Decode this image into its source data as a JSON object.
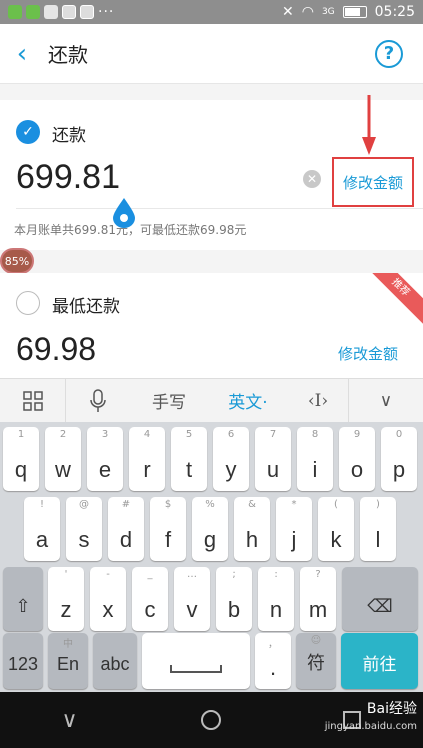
{
  "status_bar": {
    "network": "3G",
    "time": "05:25",
    "dots": "···"
  },
  "header": {
    "title": "还款",
    "back_icon": "‹",
    "help_icon": "?"
  },
  "repay_full": {
    "label": "还款",
    "amount": "699.81",
    "edit_label": "修改金额",
    "summary": "本月账单共699.81元，可最低还款69.98元"
  },
  "progress_badge": "85%",
  "repay_min": {
    "label": "最低还款",
    "amount": "69.98",
    "edit_label": "修改金额",
    "ribbon": "推荐"
  },
  "keyboard_toolbar": {
    "grid_icon": "grid-icon",
    "mic_icon": "mic-icon",
    "handwrite": "手写",
    "english": "英文·",
    "cursor": "‹I›",
    "collapse": "∨"
  },
  "keyboard": {
    "row1": [
      {
        "main": "q",
        "sub": "1"
      },
      {
        "main": "w",
        "sub": "2"
      },
      {
        "main": "e",
        "sub": "3"
      },
      {
        "main": "r",
        "sub": "4"
      },
      {
        "main": "t",
        "sub": "5"
      },
      {
        "main": "y",
        "sub": "6"
      },
      {
        "main": "u",
        "sub": "7"
      },
      {
        "main": "i",
        "sub": "8"
      },
      {
        "main": "o",
        "sub": "9"
      },
      {
        "main": "p",
        "sub": "0"
      }
    ],
    "row2": [
      {
        "main": "a",
        "sub": "!"
      },
      {
        "main": "s",
        "sub": "@"
      },
      {
        "main": "d",
        "sub": "#"
      },
      {
        "main": "f",
        "sub": "$"
      },
      {
        "main": "g",
        "sub": "%"
      },
      {
        "main": "h",
        "sub": "&"
      },
      {
        "main": "j",
        "sub": "*"
      },
      {
        "main": "k",
        "sub": "("
      },
      {
        "main": "l",
        "sub": ")"
      }
    ],
    "row3": [
      {
        "main": "z",
        "sub": "'"
      },
      {
        "main": "x",
        "sub": "-"
      },
      {
        "main": "c",
        "sub": "_"
      },
      {
        "main": "v",
        "sub": "…"
      },
      {
        "main": "b",
        "sub": ";"
      },
      {
        "main": "n",
        "sub": ":"
      },
      {
        "main": "m",
        "sub": "?"
      }
    ],
    "shift": "⇧",
    "backspace": "⌫",
    "num": "123",
    "en": "En",
    "en_sub": "中",
    "abc": "abc",
    "period": ".",
    "period_sub": "，",
    "symbol": "符",
    "symbol_sub": "☺",
    "enter": "前往"
  },
  "nav": {
    "back": "∨"
  },
  "watermark": {
    "main": "Bai经验",
    "sub": "jingyan.baidu.com"
  },
  "colors": {
    "accent": "#1a9ad6",
    "highlight": "#e04040",
    "enter": "#2bb4c8"
  }
}
